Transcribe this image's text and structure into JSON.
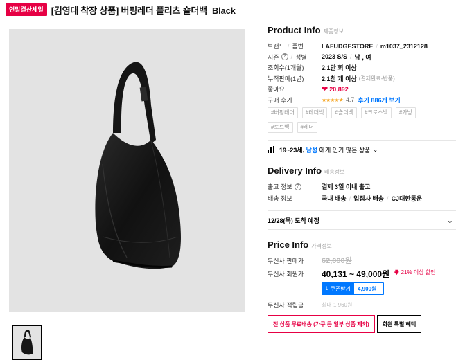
{
  "header": {
    "badge": "연말결산세일",
    "title": "[김영대 착장 상품] 버핑레더 플리츠 숄더백_Black"
  },
  "product_info": {
    "title": "Product Info",
    "subtitle": "제품정보",
    "rows": {
      "brand": {
        "label": "브랜드",
        "sep": "/",
        "label2": "품번",
        "brand": "LAFUDGESTORE",
        "sep_val": "/",
        "code": "m1037_2312128"
      },
      "season": {
        "label": "시즌",
        "sep": "/",
        "label2": "성별",
        "season": "2023 S/S",
        "sep_val": "/",
        "gender": "남 , 여"
      },
      "views": {
        "label": "조회수(1개월)",
        "value": "2.1만 회 이상"
      },
      "sales": {
        "label": "누적판매(1년)",
        "value": "2.1천 개 이상",
        "note": "(결제완료-반품)"
      },
      "likes": {
        "label": "좋아요",
        "value": "20,892"
      },
      "reviews": {
        "label": "구매 후기",
        "stars": "★★★★★",
        "rating": "4.7",
        "link": "후기 886개 보기"
      }
    },
    "tags": [
      "#버핑레더",
      "#레더백",
      "#숄더백",
      "#크로스백",
      "#가방",
      "#토트백",
      "#레더"
    ]
  },
  "popular": {
    "range": "19~23세",
    "sep": ",",
    "gender": "남성",
    "suffix": "에게 인기 많은 상품"
  },
  "delivery": {
    "title": "Delivery Info",
    "subtitle": "배송정보",
    "rows": {
      "ship_from": {
        "label": "출고 정보",
        "value": "결제 3일 이내 출고"
      },
      "ship_info": {
        "label": "배송 정보",
        "v1": "국내 배송",
        "v2": "입점사 배송",
        "v3": "CJ대한통운",
        "sep": "/"
      }
    },
    "arrival": "12/28(목) 도착 예정"
  },
  "price": {
    "title": "Price Info",
    "subtitle": "가격정보",
    "sale_label": "무신사 판매가",
    "sale_price": "62,000원",
    "member_label": "무신사 회원가",
    "member_price": "40,131 ~ 49,000원",
    "discount": "21% 이상 할인",
    "coupon_btn": "쿠폰받기",
    "coupon_amt": "4,900원",
    "points_label": "무신사 적립금",
    "points_value": "최대 1,960원",
    "free_ship_btn": "전 상품 무료배송 (가구 등 일부 상품 제외)",
    "member_benefit_btn": "회원 특별 혜택"
  },
  "colors": {
    "accent": "#e60044",
    "link": "#0078ff",
    "star": "#f5a623"
  }
}
